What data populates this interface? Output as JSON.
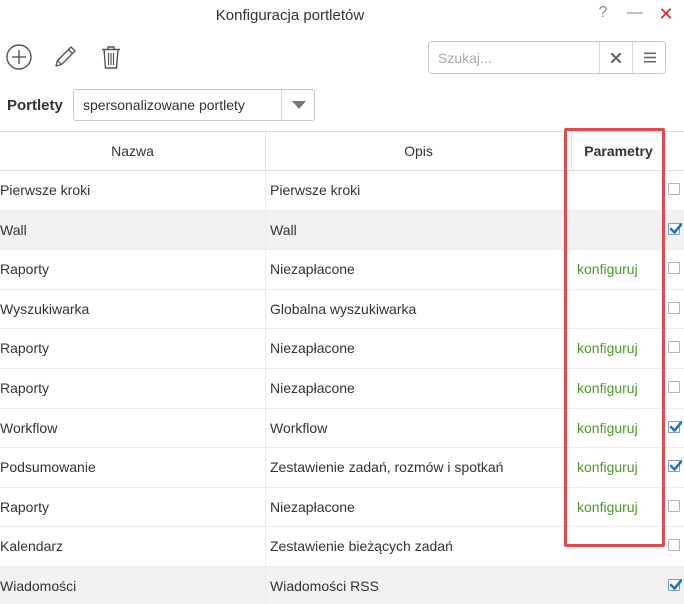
{
  "window": {
    "title": "Konfiguracja portletów",
    "help_label": "?",
    "minimize_label": "—",
    "close_label": "✕"
  },
  "toolbar": {
    "add_icon": "plus-circle-icon",
    "edit_icon": "pencil-icon",
    "delete_icon": "trash-icon"
  },
  "search": {
    "value": "",
    "placeholder": "Szukaj...",
    "clear_icon": "x-icon",
    "menu_icon": "hamburger-icon"
  },
  "filter": {
    "label": "Portlety",
    "selected": "spersonalizowane portlety"
  },
  "table": {
    "columns": [
      "Nazwa",
      "Opis",
      "Parametry"
    ],
    "rows": [
      {
        "name": "Pierwsze kroki",
        "desc": "Pierwsze kroki",
        "params": "",
        "checked": false
      },
      {
        "name": "Wall",
        "desc": "Wall",
        "params": "",
        "checked": true
      },
      {
        "name": "Raporty",
        "desc": "Niezapłacone",
        "params": "konfiguruj",
        "checked": false
      },
      {
        "name": "Wyszukiwarka",
        "desc": "Globalna wyszukiwarka",
        "params": "",
        "checked": false
      },
      {
        "name": "Raporty",
        "desc": "Niezapłacone",
        "params": "konfiguruj",
        "checked": false
      },
      {
        "name": "Raporty",
        "desc": "Niezapłacone",
        "params": "konfiguruj",
        "checked": false
      },
      {
        "name": "Workflow",
        "desc": "Workflow",
        "params": "konfiguruj",
        "checked": true
      },
      {
        "name": "Podsumowanie",
        "desc": "Zestawienie zadań, rozmów i spotkań",
        "params": "konfiguruj",
        "checked": true
      },
      {
        "name": "Raporty",
        "desc": "Niezapłacone",
        "params": "konfiguruj",
        "checked": false
      },
      {
        "name": "Kalendarz",
        "desc": "Zestawienie bieżących zadań",
        "params": "",
        "checked": false
      },
      {
        "name": "Wiadomości",
        "desc": "Wiadomości RSS",
        "params": "",
        "checked": true
      }
    ]
  },
  "colors": {
    "link_green": "#4a9a28",
    "highlight_red": "#e5484d",
    "close_red": "#d9262c",
    "check_blue": "#1e73be"
  }
}
